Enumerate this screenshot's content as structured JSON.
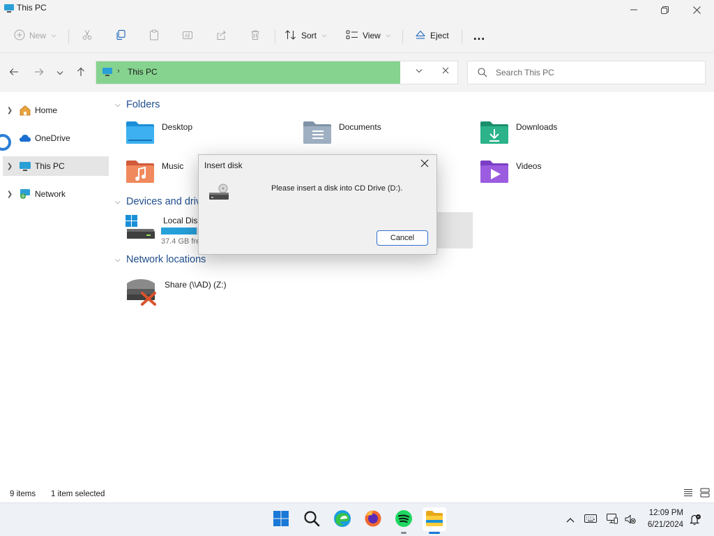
{
  "window": {
    "title": "This PC"
  },
  "toolbar": {
    "new_label": "New",
    "sort_label": "Sort",
    "view_label": "View",
    "eject_label": "Eject",
    "more_label": "…"
  },
  "address": {
    "path": "This PC",
    "search_placeholder": "Search This PC"
  },
  "sidebar": {
    "items": [
      {
        "label": "Home"
      },
      {
        "label": "OneDrive"
      },
      {
        "label": "This PC"
      },
      {
        "label": "Network"
      }
    ]
  },
  "sections": {
    "folders_title": "Folders",
    "devices_title": "Devices and driv",
    "network_title": "Network locations"
  },
  "folders": [
    {
      "name": "Desktop"
    },
    {
      "name": "Documents"
    },
    {
      "name": "Downloads"
    },
    {
      "name": "Music"
    },
    {
      "name": "Videos"
    }
  ],
  "drive": {
    "name": "Local Disk",
    "free_text": "37.4 GB fre",
    "used_fraction": 0.85
  },
  "network_locations": [
    {
      "name": "Share (\\\\AD) (Z:)"
    }
  ],
  "dialog": {
    "title": "Insert disk",
    "message": "Please insert a disk into CD Drive (D:).",
    "cancel_label": "Cancel"
  },
  "status": {
    "item_count": "9 items",
    "selection": "1 item selected"
  },
  "taskbar": {
    "apps": [
      "windows-start",
      "search",
      "edge",
      "firefox",
      "spotify",
      "file-explorer"
    ],
    "time": "12:09 PM",
    "date": "6/21/2024"
  },
  "colors": {
    "address_highlight": "#86d38f",
    "accent": "#2f6fd1",
    "section_heading": "#1f4e8c"
  }
}
